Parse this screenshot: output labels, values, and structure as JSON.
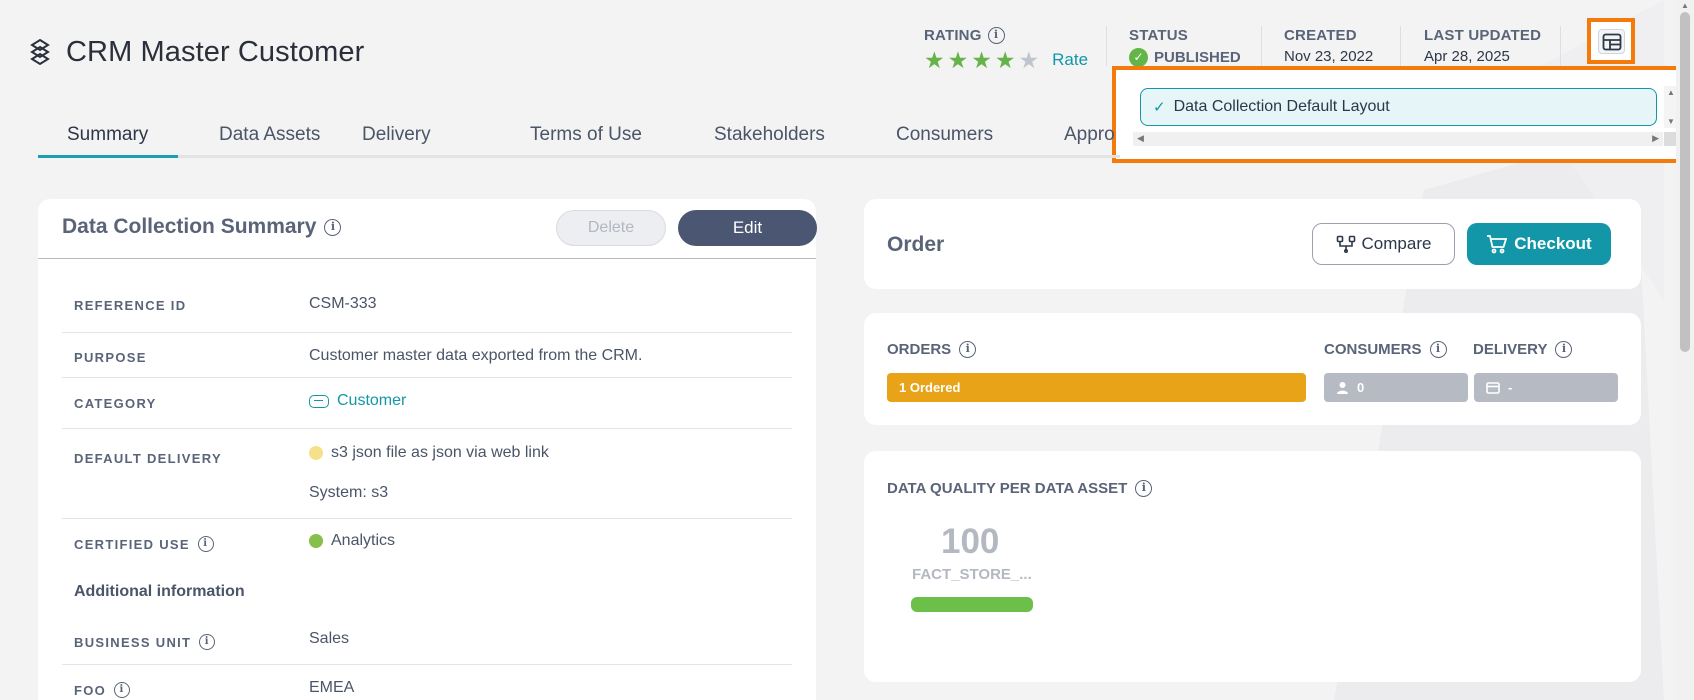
{
  "header": {
    "title": "CRM Master Customer",
    "rating": {
      "label": "RATING",
      "stars": 4,
      "max": 5,
      "rate_link": "Rate"
    },
    "status": {
      "label": "STATUS",
      "value": "PUBLISHED"
    },
    "created": {
      "label": "CREATED",
      "value": "Nov 23, 2022"
    },
    "last_updated": {
      "label": "LAST UPDATED",
      "value": "Apr 28, 2025"
    }
  },
  "layout_dropdown": {
    "selected_option": "Data Collection Default Layout"
  },
  "tabs": [
    {
      "label": "Summary",
      "active": true
    },
    {
      "label": "Data Assets"
    },
    {
      "label": "Delivery"
    },
    {
      "label": "Terms of Use"
    },
    {
      "label": "Stakeholders"
    },
    {
      "label": "Consumers"
    },
    {
      "label": "Appro"
    }
  ],
  "summary": {
    "title": "Data Collection Summary",
    "delete_label": "Delete",
    "edit_label": "Edit",
    "fields": {
      "reference_id": {
        "label": "REFERENCE ID",
        "value": "CSM-333"
      },
      "purpose": {
        "label": "PURPOSE",
        "value": "Customer master data exported from the CRM."
      },
      "category": {
        "label": "CATEGORY",
        "value": "Customer"
      },
      "default_delivery": {
        "label": "DEFAULT DELIVERY",
        "value": "s3 json file as json via web link",
        "system": "System: s3"
      },
      "certified_use": {
        "label": "CERTIFIED USE",
        "value": "Analytics"
      },
      "additional_title": "Additional information",
      "business_unit": {
        "label": "BUSINESS UNIT",
        "value": "Sales"
      },
      "foo": {
        "label": "FOO",
        "value": "EMEA"
      }
    }
  },
  "order": {
    "title": "Order",
    "compare_label": "Compare",
    "checkout_label": "Checkout"
  },
  "stats": {
    "orders": {
      "label": "ORDERS",
      "bar_text": "1 Ordered"
    },
    "consumers": {
      "label": "CONSUMERS",
      "value": "0"
    },
    "delivery": {
      "label": "DELIVERY",
      "value": "-"
    }
  },
  "data_quality": {
    "title": "DATA QUALITY PER DATA ASSET",
    "score": "100",
    "asset_name": "FACT_STORE_...",
    "fill": 1.0
  },
  "colors": {
    "accent": "#1296a8",
    "highlight": "#f57a0c",
    "orders_bar": "#e8a318",
    "quality_bar": "#6cc04a",
    "edit_button": "#4a5672"
  }
}
